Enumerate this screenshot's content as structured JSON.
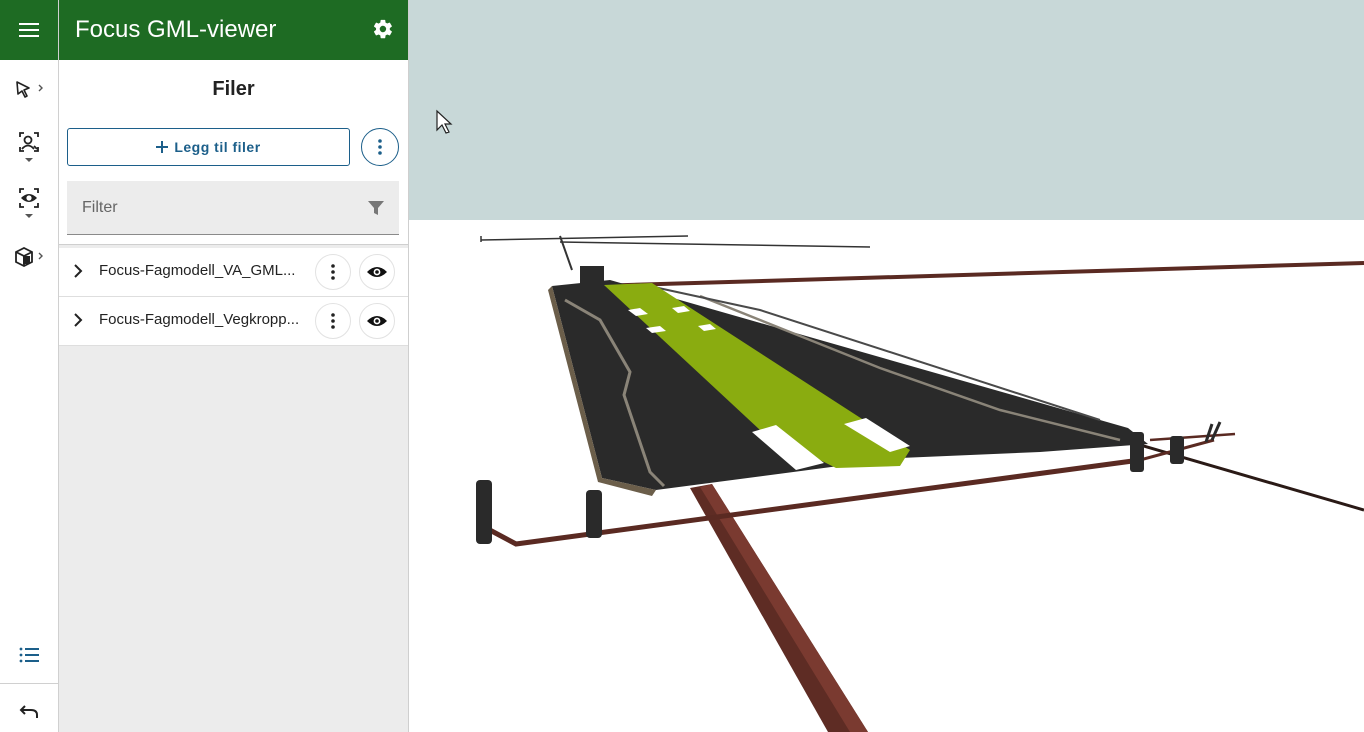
{
  "app": {
    "title": "Focus GML-viewer"
  },
  "rail": {
    "tools": [
      {
        "icon": "select-cursor-icon"
      },
      {
        "icon": "zoom-person-icon"
      },
      {
        "icon": "visibility-eye-icon"
      },
      {
        "icon": "object-box-icon"
      },
      {
        "icon": "list-icon"
      },
      {
        "icon": "undo-icon"
      }
    ]
  },
  "panel": {
    "title": "Filer",
    "add_files_label": "Legg til filer",
    "filter_placeholder": "Filter",
    "files": [
      {
        "name": "Focus-Fagmodell_VA_GML..."
      },
      {
        "name": "Focus-Fagmodell_Vegkropp..."
      }
    ]
  },
  "colors": {
    "header_green": "#1e6b23",
    "accent_blue": "#1c5f8a",
    "sky": "#c8d8d8",
    "road_surface": "#2a2a2a",
    "green_strip": "#8aac10",
    "pipe_brown": "#5a2a22"
  }
}
